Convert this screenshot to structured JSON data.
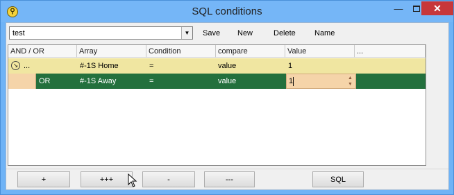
{
  "window": {
    "title": "SQL conditions",
    "app_icon_glyph": "⚲",
    "minimize_glyph": "—",
    "close_glyph": "✕"
  },
  "toolbar": {
    "combo_value": "test",
    "combo_arrow": "▼",
    "save_label": "Save",
    "new_label": "New",
    "delete_label": "Delete",
    "name_label": "Name"
  },
  "grid": {
    "columns": [
      "AND / OR",
      "Array",
      "Condition",
      "compare",
      "Value",
      "..."
    ],
    "rows": [
      {
        "expand_glyph": "↘",
        "and_or": "...",
        "array": "#-1S Home",
        "condition": "=",
        "compare": "value",
        "value": "1"
      },
      {
        "and_or": "OR",
        "array": "#-1S Away",
        "condition": "=",
        "compare": "value",
        "value": "1"
      }
    ],
    "spin_up": "▲",
    "spin_down": "▼"
  },
  "buttons": {
    "plus": "+",
    "plus_all": "+++",
    "minus": "-",
    "minus_all": "---",
    "sql": "SQL"
  },
  "colors": {
    "title_bar": "#75b6f7",
    "close_button": "#c7373a",
    "row_highlight": "#f0e6a1",
    "selected_row": "#23703d",
    "editor_bg": "#f5d4a9"
  }
}
